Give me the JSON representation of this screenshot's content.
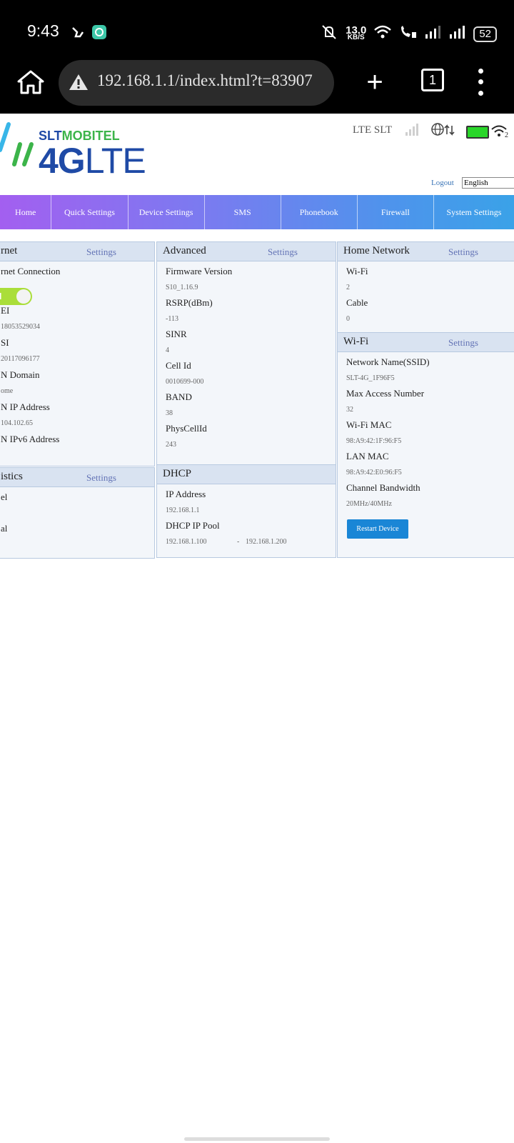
{
  "status_bar": {
    "time": "9:43",
    "speed_value": "13.0",
    "speed_unit": "KB/S",
    "battery": "52",
    "icons": [
      "gesture-icon",
      "app-notification-icon",
      "mute-icon",
      "wifi-icon",
      "wifi-call-icon",
      "signal-icon",
      "signal-icon-2",
      "battery-icon"
    ]
  },
  "browser": {
    "url": "192.168.1.1/index.html?t=83907",
    "tab_count": "1"
  },
  "header": {
    "logo_top_a": "SLT",
    "logo_top_b": "MOBITEL",
    "logo_main_a": "4G",
    "logo_main_b": "LTE",
    "network": "LTE SLT",
    "wifi_clients": "2",
    "logout": "Logout",
    "language": "English",
    "battery_color": "#29d629"
  },
  "nav": [
    "Home",
    "Quick Settings",
    "Device Settings",
    "SMS",
    "Phonebook",
    "Firewall",
    "System Settings"
  ],
  "internet": {
    "title": "rnet",
    "settings": "Settings",
    "conn_label": "rnet Connection",
    "toggle": "N",
    "imei_label": "EI",
    "imei": "18053529034",
    "imsi_label": "SI",
    "imsi": "20117096177",
    "domain_label": "N Domain",
    "domain": "ome",
    "ip_label": "N IP Address",
    "ip": "104.102.65",
    "ipv6_label": "N IPv6 Address"
  },
  "statistics": {
    "title": "istics",
    "settings": "Settings",
    "row1": "el",
    "row2": "al"
  },
  "advanced": {
    "title": "Advanced",
    "settings": "Settings",
    "fw_label": "Firmware Version",
    "fw": "S10_1.16.9",
    "rsrp_label": "RSRP(dBm)",
    "rsrp": "-113",
    "sinr_label": "SINR",
    "sinr": "4",
    "cell_label": "Cell Id",
    "cell": "0010699-000",
    "band_label": "BAND",
    "band": "38",
    "pci_label": "PhysCellId",
    "pci": "243"
  },
  "dhcp": {
    "title": "DHCP",
    "ip_label": "IP Address",
    "ip": "192.168.1.1",
    "pool_label": "DHCP IP Pool",
    "pool_start": "192.168.1.100",
    "pool_sep": "-",
    "pool_end": "192.168.1.200"
  },
  "home_network": {
    "title": "Home Network",
    "settings": "Settings",
    "wifi_label": "Wi-Fi",
    "wifi": "2",
    "cable_label": "Cable",
    "cable": "0"
  },
  "wifi": {
    "title": "Wi-Fi",
    "settings": "Settings",
    "ssid_label": "Network Name(SSID)",
    "ssid": "SLT-4G_1F96F5",
    "max_label": "Max Access Number",
    "max": "32",
    "mac_label": "Wi-Fi MAC",
    "mac": "98:A9:42:1F:96:F5",
    "lan_label": "LAN MAC",
    "lan": "98:A9:42:E0:96:F5",
    "bw_label": "Channel Bandwidth",
    "bw": "20MHz/40MHz",
    "restart": "Restart Device"
  }
}
